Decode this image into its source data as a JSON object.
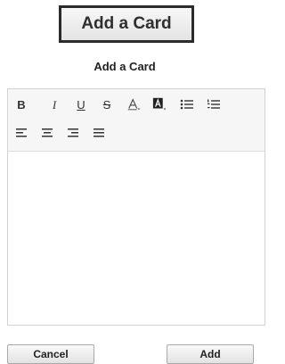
{
  "header": {
    "add_card_button": "Add a Card"
  },
  "dialog": {
    "title": "Add a Card",
    "toolbar": {
      "bold": "B",
      "italic": "I",
      "underline": "U",
      "strikethrough": "S",
      "font_color": "A",
      "highlight": "A"
    },
    "editor_content": "",
    "buttons": {
      "cancel": "Cancel",
      "add": "Add"
    }
  },
  "icons": [
    "bold-icon",
    "italic-icon",
    "underline-icon",
    "strikethrough-icon",
    "font-color-icon",
    "highlight-color-icon",
    "bullet-list-icon",
    "numbered-list-icon",
    "align-left-icon",
    "align-center-icon",
    "align-right-icon",
    "align-justify-icon"
  ],
  "colors": {
    "highlight_box": "#222222",
    "toolbar_bg": "#f6f6f6",
    "border": "#d3d3d3"
  }
}
